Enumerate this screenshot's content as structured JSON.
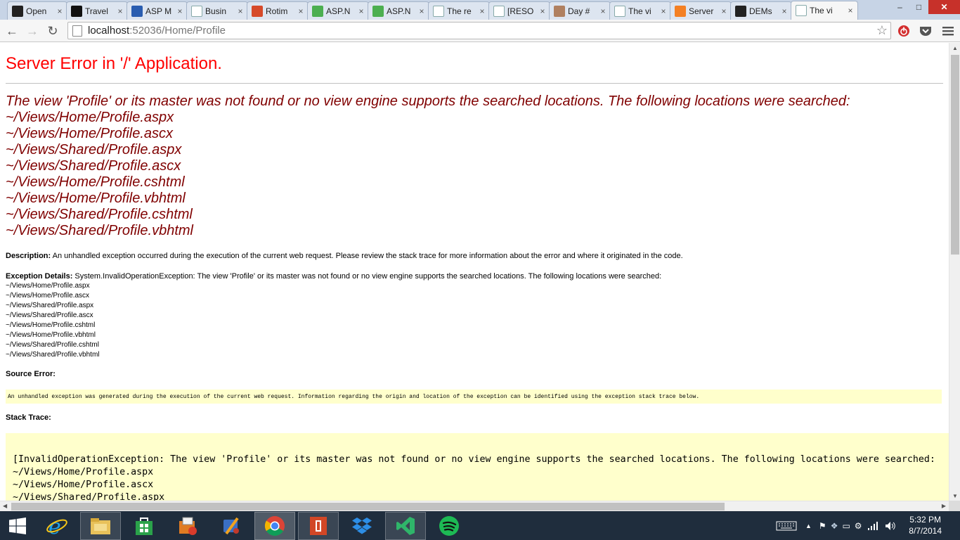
{
  "browser": {
    "tabs": [
      {
        "title": "Open",
        "favicon": "ijr-logo-icon",
        "color": "#222222"
      },
      {
        "title": "Travel",
        "favicon": "engadget-e-icon",
        "color": "#111111"
      },
      {
        "title": "ASP M",
        "favicon": "asp-logo-icon",
        "color": "#2a5db0"
      },
      {
        "title": "Busin",
        "favicon": "page-icon",
        "color": "#ffffff"
      },
      {
        "title": "Rotim",
        "favicon": "rotimi-r-icon",
        "color": "#d64a2a"
      },
      {
        "title": "ASP.N",
        "favicon": "green-codeplex-icon",
        "color": "#4caf50"
      },
      {
        "title": "ASP.N",
        "favicon": "green-codeplex-icon",
        "color": "#4caf50"
      },
      {
        "title": "The re",
        "favicon": "page-icon",
        "color": "#ffffff"
      },
      {
        "title": "[RESO",
        "favicon": "page-icon",
        "color": "#ffffff"
      },
      {
        "title": "Day #",
        "favicon": "avatar-icon",
        "color": "#b08060"
      },
      {
        "title": "The vi",
        "favicon": "page-icon",
        "color": "#ffffff"
      },
      {
        "title": "Server",
        "favicon": "stackoverflow-icon",
        "color": "#f48024"
      },
      {
        "title": "DEMs",
        "favicon": "ijr-logo-icon",
        "color": "#222222"
      },
      {
        "title": "The vi",
        "favicon": "page-icon",
        "color": "#ffffff"
      }
    ],
    "url_host": "localhost",
    "url_rest": ":52036/Home/Profile"
  },
  "page": {
    "heading": "Server Error in '/' Application.",
    "error_title": "The view 'Profile' or its master was not found or no view engine supports the searched locations. The following locations were searched:",
    "locations": [
      "~/Views/Home/Profile.aspx",
      "~/Views/Home/Profile.ascx",
      "~/Views/Shared/Profile.aspx",
      "~/Views/Shared/Profile.ascx",
      "~/Views/Home/Profile.cshtml",
      "~/Views/Home/Profile.vbhtml",
      "~/Views/Shared/Profile.cshtml",
      "~/Views/Shared/Profile.vbhtml"
    ],
    "description_label": "Description:",
    "description_text": " An unhandled exception occurred during the execution of the current web request. Please review the stack trace for more information about the error and where it originated in the code.",
    "exception_label": "Exception Details:",
    "exception_text": " System.InvalidOperationException: The view 'Profile' or its master was not found or no view engine supports the searched locations. The following locations were searched:",
    "source_error_label": "Source Error:",
    "source_error_text": "An unhandled exception was generated during the execution of the current web request. Information regarding the origin and location of the exception can be identified using the exception stack trace below.",
    "stack_trace_label": "Stack Trace:",
    "stack_first_line": "[InvalidOperationException: The view 'Profile' or its master was not found or no view engine supports the searched locations. The following locations were searched:",
    "stack_locations": [
      "~/Views/Home/Profile.aspx",
      "~/Views/Home/Profile.ascx",
      "~/Views/Shared/Profile.aspx"
    ]
  },
  "taskbar": {
    "time": "5:32 PM",
    "date": "8/7/2014"
  },
  "colors": {
    "error_red": "#ff0000",
    "error_maroon": "#800000",
    "code_background": "#ffffcc",
    "taskbar": "#1f2d3d"
  }
}
